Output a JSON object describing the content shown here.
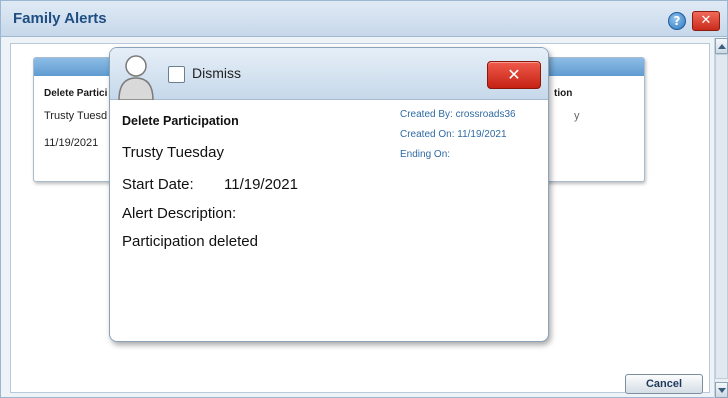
{
  "window": {
    "title": "Family Alerts",
    "help_glyph": "?",
    "close_glyph": "✕"
  },
  "card": {
    "title": "Delete Partici",
    "name": "Trusty Tuesd",
    "date": "11/19/2021",
    "right_header": "tion",
    "right_value": "y"
  },
  "footer": {
    "cancel_label": "Cancel"
  },
  "popup": {
    "dismiss_label": "Dismiss",
    "close_glyph": "✕",
    "title": "Delete Participation",
    "name": "Trusty Tuesday",
    "start_date_label": "Start Date:",
    "start_date_value": "11/19/2021",
    "description_label": "Alert Description:",
    "description": "Participation deleted",
    "created_by": "Created By: crossroads36",
    "created_on": "Created On: 11/19/2021",
    "ending_on": "Ending On:"
  },
  "colors": {
    "title_text": "#1f4e83",
    "card_header": "#6fa8d9",
    "close_red": "#d8321f",
    "meta_text": "#2f6aa3"
  },
  "icons": [
    "help-icon",
    "close-icon",
    "avatar-icon",
    "checkbox-icon",
    "scroll-up-icon",
    "scroll-down-icon"
  ]
}
